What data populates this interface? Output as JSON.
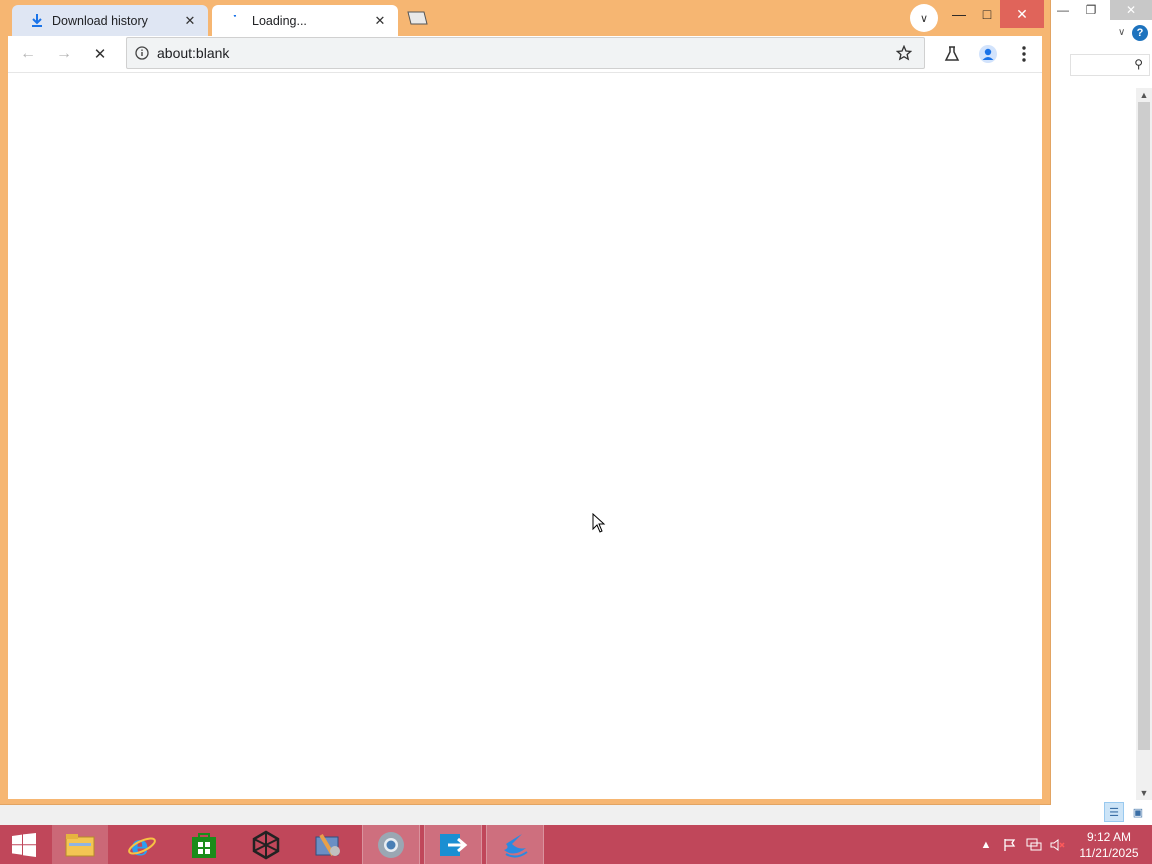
{
  "browser": {
    "tabs": [
      {
        "title": "Download history",
        "icon": "download-icon",
        "active": false
      },
      {
        "title": "Loading...",
        "icon": "loading-spinner-icon",
        "active": true
      }
    ],
    "address": "about:blank",
    "frame_color": "#f6b672"
  },
  "taskbar": {
    "time": "9:12 AM",
    "date": "11/21/2025",
    "color": "#c0475a"
  }
}
